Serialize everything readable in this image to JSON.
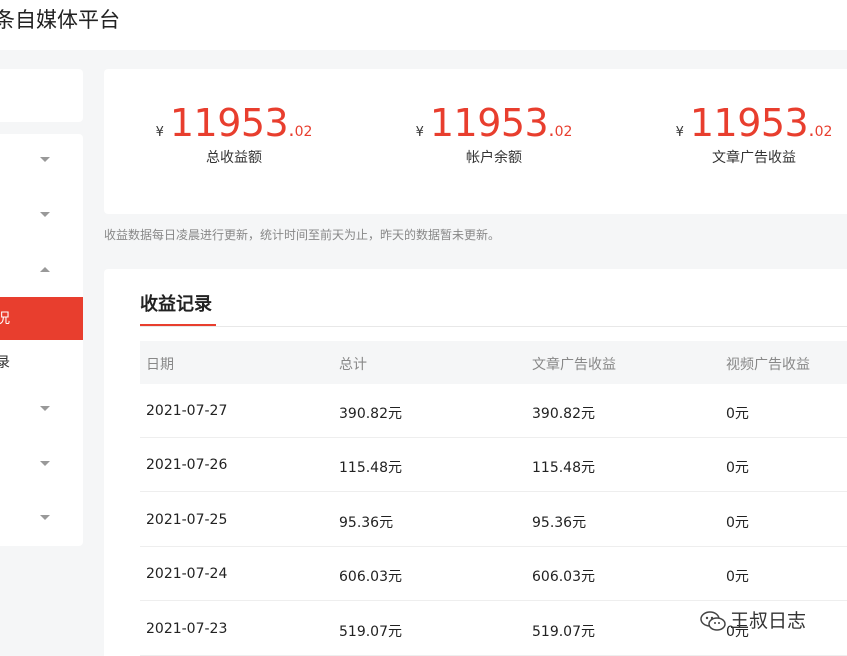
{
  "header": {
    "title": "条自媒体平台"
  },
  "sidebar": {
    "active_label": "况",
    "item_label": "录"
  },
  "summary": [
    {
      "currency": "¥",
      "integer": "11953",
      "dot": ".",
      "decimal": "02",
      "label": "总收益额"
    },
    {
      "currency": "¥",
      "integer": "11953",
      "dot": ".",
      "decimal": "02",
      "label": "帐户余额"
    },
    {
      "currency": "¥",
      "integer": "11953",
      "dot": ".",
      "decimal": "02",
      "label": "文章广告收益"
    }
  ],
  "note": "收益数据每日凌晨进行更新，统计时间至前天为止，昨天的数据暂未更新。",
  "records": {
    "tab": "收益记录",
    "columns": [
      "日期",
      "总计",
      "文章广告收益",
      "视频广告收益"
    ],
    "rows": [
      [
        "2021-07-27",
        "390.82元",
        "390.82元",
        "0元"
      ],
      [
        "2021-07-26",
        "115.48元",
        "115.48元",
        "0元"
      ],
      [
        "2021-07-25",
        "95.36元",
        "95.36元",
        "0元"
      ],
      [
        "2021-07-24",
        "606.03元",
        "606.03元",
        "0元"
      ],
      [
        "2021-07-23",
        "519.07元",
        "519.07元",
        "0元"
      ]
    ]
  },
  "watermark": {
    "text": "王叔日志",
    "icon": "wechat-icon"
  },
  "colors": {
    "accent": "#e83e2e",
    "background": "#f5f6f7"
  }
}
